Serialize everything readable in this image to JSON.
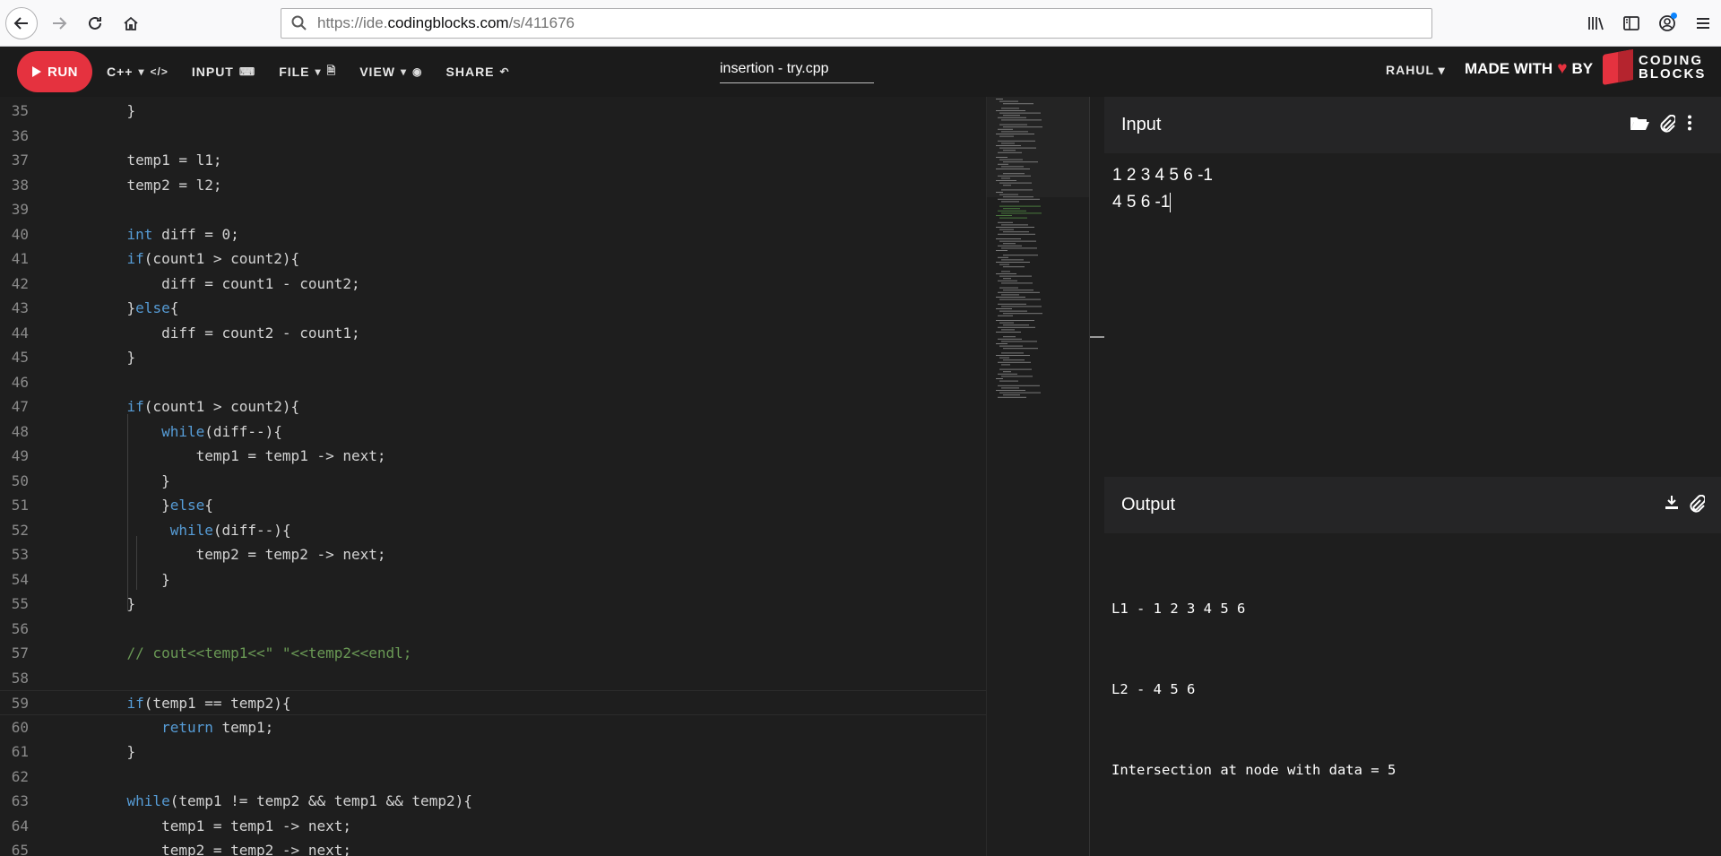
{
  "browser": {
    "url_prefix": "https://ide.",
    "url_host": "codingblocks.com",
    "url_path": "/s/411676"
  },
  "header": {
    "run_label": "RUN",
    "language_label": "C++",
    "input_label": "INPUT",
    "file_label": "FILE",
    "view_label": "VIEW",
    "share_label": "SHARE",
    "filename": "insertion - try.cpp",
    "user_label": "RAHUL",
    "made_with_prefix": "MADE WITH",
    "made_with_suffix": "BY",
    "brand_line1": "CODING",
    "brand_line2": "BLOCKS"
  },
  "editor": {
    "current_line": 59,
    "lines": [
      {
        "n": "35",
        "tokens": [
          {
            "t": "    }"
          }
        ]
      },
      {
        "n": "36",
        "tokens": []
      },
      {
        "n": "37",
        "tokens": [
          {
            "t": "    temp1 = l1;"
          }
        ]
      },
      {
        "n": "38",
        "tokens": [
          {
            "t": "    temp2 = l2;"
          }
        ]
      },
      {
        "n": "39",
        "tokens": []
      },
      {
        "n": "40",
        "tokens": [
          {
            "t": "    "
          },
          {
            "t": "int",
            "c": "kw"
          },
          {
            "t": " diff = 0;"
          }
        ]
      },
      {
        "n": "41",
        "tokens": [
          {
            "t": "    "
          },
          {
            "t": "if",
            "c": "kw"
          },
          {
            "t": "(count1 > count2){"
          }
        ]
      },
      {
        "n": "42",
        "tokens": [
          {
            "t": "        diff = count1 - count2;"
          }
        ]
      },
      {
        "n": "43",
        "tokens": [
          {
            "t": "    }"
          },
          {
            "t": "else",
            "c": "kw"
          },
          {
            "t": "{"
          }
        ]
      },
      {
        "n": "44",
        "tokens": [
          {
            "t": "        diff = count2 - count1;"
          }
        ]
      },
      {
        "n": "45",
        "tokens": [
          {
            "t": "    }"
          }
        ]
      },
      {
        "n": "46",
        "tokens": []
      },
      {
        "n": "47",
        "tokens": [
          {
            "t": "    "
          },
          {
            "t": "if",
            "c": "kw"
          },
          {
            "t": "(count1 > count2){"
          }
        ]
      },
      {
        "n": "48",
        "tokens": [
          {
            "t": "        "
          },
          {
            "t": "while",
            "c": "kw"
          },
          {
            "t": "(diff--){"
          }
        ]
      },
      {
        "n": "49",
        "tokens": [
          {
            "t": "            temp1 = temp1 -> next;"
          }
        ]
      },
      {
        "n": "50",
        "tokens": [
          {
            "t": "        }"
          }
        ]
      },
      {
        "n": "51",
        "tokens": [
          {
            "t": "        }"
          },
          {
            "t": "else",
            "c": "kw"
          },
          {
            "t": "{"
          }
        ]
      },
      {
        "n": "52",
        "tokens": [
          {
            "t": "         "
          },
          {
            "t": "while",
            "c": "kw"
          },
          {
            "t": "(diff--){"
          }
        ]
      },
      {
        "n": "53",
        "tokens": [
          {
            "t": "            temp2 = temp2 -> next;"
          }
        ]
      },
      {
        "n": "54",
        "tokens": [
          {
            "t": "        }"
          }
        ]
      },
      {
        "n": "55",
        "tokens": [
          {
            "t": "    }"
          }
        ]
      },
      {
        "n": "56",
        "tokens": []
      },
      {
        "n": "57",
        "tokens": [
          {
            "t": "    "
          },
          {
            "t": "// cout<<temp1<<\" \"<<temp2<<endl;",
            "c": "cm"
          }
        ]
      },
      {
        "n": "58",
        "tokens": []
      },
      {
        "n": "59",
        "tokens": [
          {
            "t": "    "
          },
          {
            "t": "if",
            "c": "kw"
          },
          {
            "t": "(temp1 == temp2){"
          }
        ]
      },
      {
        "n": "60",
        "tokens": [
          {
            "t": "        "
          },
          {
            "t": "return",
            "c": "kw"
          },
          {
            "t": " temp1;"
          }
        ]
      },
      {
        "n": "61",
        "tokens": [
          {
            "t": "    }"
          }
        ]
      },
      {
        "n": "62",
        "tokens": []
      },
      {
        "n": "63",
        "tokens": [
          {
            "t": "    "
          },
          {
            "t": "while",
            "c": "kw"
          },
          {
            "t": "(temp1 != temp2 && temp1 && temp2){"
          }
        ]
      },
      {
        "n": "64",
        "tokens": [
          {
            "t": "        temp1 = temp1 -> next;"
          }
        ]
      },
      {
        "n": "65",
        "tokens": [
          {
            "t": "        temp2 = temp2 -> next;"
          }
        ]
      }
    ]
  },
  "input_panel": {
    "title": "Input",
    "line1": "1 2 3 4 5 6 -1",
    "line2": "4 5 6 -1"
  },
  "output_panel": {
    "title": "Output",
    "lines": [
      "L1 - 1 2 3 4 5 6",
      "L2 - 4 5 6",
      "Intersection at node with data = 5"
    ]
  },
  "colors": {
    "run": "#e5323f",
    "keyword": "#569cd6",
    "comment": "#6a9955",
    "editor_bg": "#1e1e1e"
  }
}
